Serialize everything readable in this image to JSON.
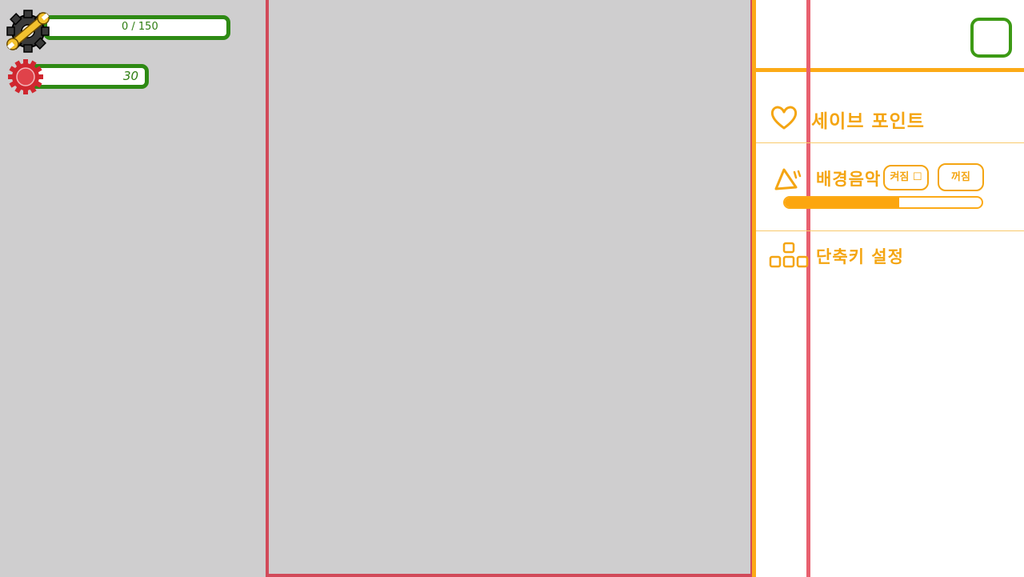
{
  "hud": {
    "repair": {
      "icon": "wrench-gear-icon",
      "label": "0 / 150",
      "value": 0,
      "max": 150
    },
    "gear": {
      "icon": "red-gear-icon",
      "label": "30",
      "value": 30
    }
  },
  "settings": {
    "close_icon": "square-close-icon",
    "save_point": {
      "icon": "heart-icon",
      "label": "세이브 포인트"
    },
    "bgm": {
      "icon": "speaker-icon",
      "label": "배경음악",
      "on_label": "켜짐 ☐",
      "off_label": "꺼짐",
      "volume": 0.58
    },
    "shortcut": {
      "icon": "keys-icon",
      "label": "단축키 설정"
    }
  },
  "colors": {
    "accent": "#fcaa17",
    "hud_green": "#2e8a14",
    "gear_red": "#d0272f",
    "play_border": "#d24a5a",
    "background": "#cfcecf"
  }
}
